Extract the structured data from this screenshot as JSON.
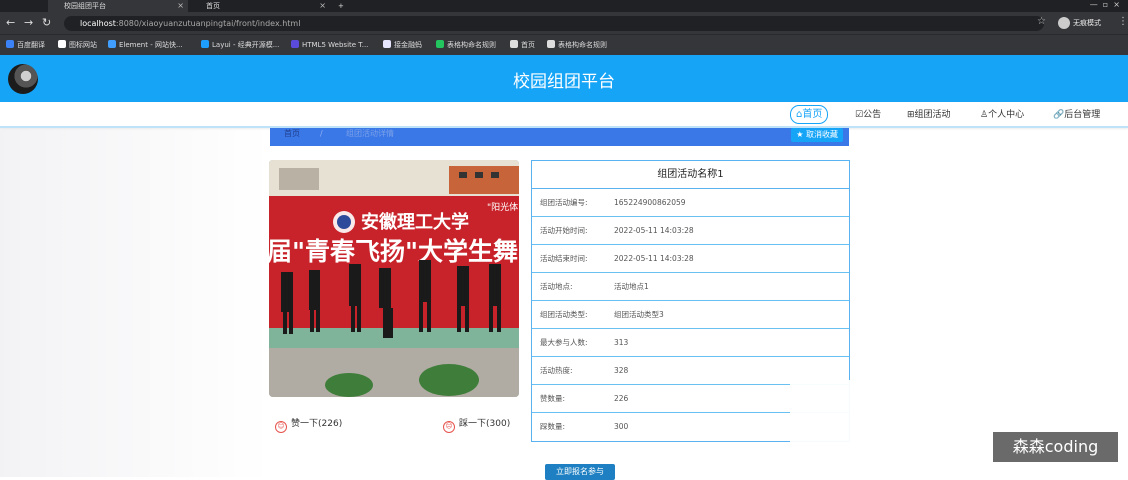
{
  "browser": {
    "tabs": [
      {
        "label": "校园组团平台"
      },
      {
        "label": "首页"
      }
    ],
    "new_tab_label": "+",
    "url_host": "localhost",
    "url_path": ":8080/xiaoyuanzutuanpingtai/front/index.html",
    "profile_label": "无痕模式",
    "bookmarks": [
      {
        "label": "百度翻译",
        "color": "#3b82f6"
      },
      {
        "label": "图标网站",
        "color": "#ffffff"
      },
      {
        "label": "Element - 网站快...",
        "color": "#409eff"
      },
      {
        "label": "Layui - 经典开源模...",
        "color": "#1e9fff"
      },
      {
        "label": "HTML5 Website T...",
        "color": "#5b4bdb"
      },
      {
        "label": "接金融蚂",
        "color": "#e6e6ff"
      },
      {
        "label": "表格构命名规则",
        "color": "#22c55e"
      },
      {
        "label": "首页",
        "color": "#dddddd"
      },
      {
        "label": "表格构命名规则",
        "color": "#dddddd"
      }
    ]
  },
  "header": {
    "title": "校园组团平台",
    "nav": [
      {
        "label": "首页",
        "icon": "home-icon"
      },
      {
        "label": "公告",
        "icon": "notice-icon"
      },
      {
        "label": "组团活动",
        "icon": "activity-icon"
      },
      {
        "label": "个人中心",
        "icon": "user-icon"
      },
      {
        "label": "后台管理",
        "icon": "link-icon"
      }
    ]
  },
  "breadcrumb": {
    "home": "首页",
    "sep": "/",
    "current": "组团活动详情",
    "fav_button": "★ 取消收藏"
  },
  "photo": {
    "banner_text": "届\"青春飞扬\"大学生舞",
    "school": "安徽理工大学",
    "corner": "\"阳光体"
  },
  "reactions": {
    "like": "赞一下(226)",
    "dislike": "踩一下(300)"
  },
  "detail": {
    "title": "组团活动名称1",
    "rows": [
      {
        "k": "组团活动编号:",
        "v": "1652249008620​59"
      },
      {
        "k": "活动开始时间:",
        "v": "2022-05-11 14:03:28"
      },
      {
        "k": "活动结束时间:",
        "v": "2022-05-11 14:03:28"
      },
      {
        "k": "活动地点:",
        "v": "活动地点1"
      },
      {
        "k": "组团活动类型:",
        "v": "组团活动类型3"
      },
      {
        "k": "最大参与人数:",
        "v": "313"
      },
      {
        "k": "活动热度:",
        "v": "328"
      },
      {
        "k": "赞数量:",
        "v": "226"
      },
      {
        "k": "踩数量:",
        "v": "300"
      }
    ],
    "join_button": "立即报名参与"
  },
  "watermark": "森森coding",
  "colors": {
    "brand": "#16a4f7",
    "crumb": "#3b78e7",
    "join": "#1e80c2"
  }
}
